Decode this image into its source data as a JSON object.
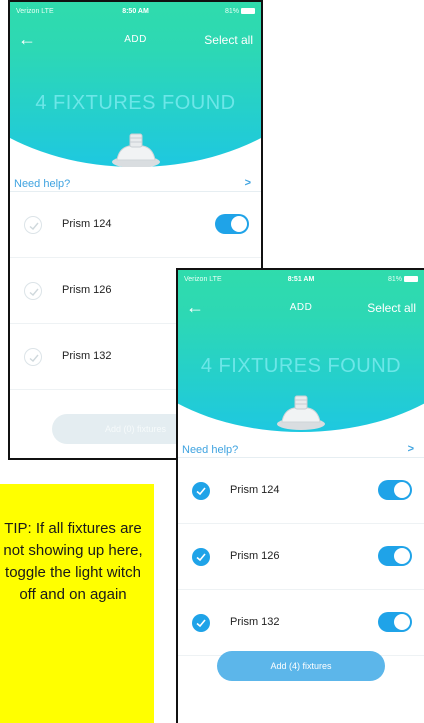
{
  "back_phone": {
    "status": {
      "carrier": "Verizon LTE",
      "time": "8:50 AM",
      "battery": "81%"
    },
    "nav": {
      "title": "ADD",
      "select_all": "Select all"
    },
    "found_label": "4 FIXTURES FOUND",
    "help": {
      "label": "Need help?",
      "chevron": ">"
    },
    "fixtures": [
      {
        "name": "Prism 124",
        "checked": false,
        "toggle_on": true
      },
      {
        "name": "Prism 126",
        "checked": false,
        "toggle_on": false
      },
      {
        "name": "Prism 132",
        "checked": false,
        "toggle_on": false
      }
    ],
    "add_button": "Add (0) fixtures"
  },
  "front_phone": {
    "status": {
      "carrier": "Verizon LTE",
      "time": "8:51 AM",
      "battery": "81%"
    },
    "nav": {
      "title": "ADD",
      "select_all": "Select all"
    },
    "found_label": "4 FIXTURES FOUND",
    "help": {
      "label": "Need help?",
      "chevron": ">"
    },
    "fixtures": [
      {
        "name": "Prism 124",
        "checked": true,
        "toggle_on": true
      },
      {
        "name": "Prism 126",
        "checked": true,
        "toggle_on": true
      },
      {
        "name": "Prism 132",
        "checked": true,
        "toggle_on": true
      }
    ],
    "add_button": "Add (4) fixtures"
  },
  "tip": {
    "text": "TIP: If all fixtures are not showing up here, toggle the light witch off and on again"
  },
  "colors": {
    "accent_blue": "#1fa3e8",
    "gradient_top": "#35e39c",
    "gradient_bottom": "#1ec8e0",
    "tip_background": "#ffff00"
  },
  "icons": {
    "back": "back-arrow-icon",
    "check": "checkmark-icon",
    "bulb": "light-fixture-icon",
    "chevron": "chevron-right-icon",
    "battery": "battery-icon"
  }
}
